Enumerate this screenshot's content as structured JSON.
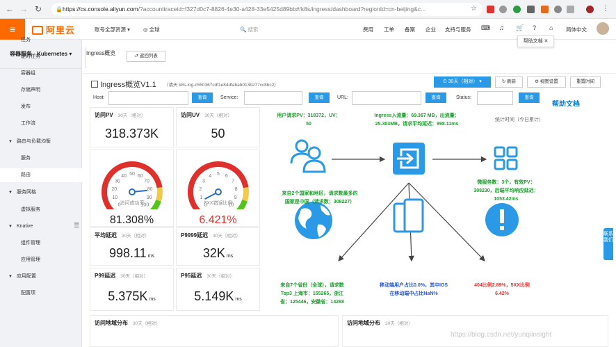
{
  "browser": {
    "url_host": "https://cs.console.aliyun.com",
    "url_rest": "/?accounttraceid=f327d0c7-8826-4e30-a428-33e5425d89bb#/k8s/ingress/dashboard?regionId=cn-beijing&c..."
  },
  "topbar": {
    "logo": "阿里云",
    "account_menu": "账号全部资源 ▾",
    "region": "全球",
    "search_placeholder": "搜索",
    "links": [
      "费用",
      "工单",
      "备案",
      "企业",
      "支持与服务"
    ],
    "lang": "简体中文",
    "help_tip": "帮助文档 ✕"
  },
  "sidebar": {
    "title": "容器服务 - Kubernetes ▾",
    "items": [
      {
        "label": "任务",
        "group": false
      },
      {
        "label": "定时任务",
        "group": false
      },
      {
        "label": "容器组",
        "group": false
      },
      {
        "label": "存储声明",
        "group": false
      },
      {
        "label": "发布",
        "group": false
      },
      {
        "label": "工作流",
        "group": false
      },
      {
        "label": "路由与负载均衡",
        "group": true
      },
      {
        "label": "服务",
        "group": false
      },
      {
        "label": "路由",
        "group": false,
        "active": true
      },
      {
        "label": "服务网格",
        "group": true
      },
      {
        "label": "虚拟服务",
        "group": false
      },
      {
        "label": "Knative",
        "group": true
      },
      {
        "label": "组件管理",
        "group": false
      },
      {
        "label": "应用管理",
        "group": false
      },
      {
        "label": "应用配置",
        "group": true
      },
      {
        "label": "配置项",
        "group": false
      }
    ]
  },
  "header": {
    "crumb": "Ingress概览",
    "back_label": "⮐ 返回列表",
    "dashboard_title": "Ingress概览V1.1",
    "dashboard_id": "（请天 k8s-log-c550367cdf1e84dfabab013b277cc8bc2）",
    "time_range": "⏱ 30天（相对） ▾",
    "refresh": "↻ 刷新",
    "settings": "⚙ 视图设置",
    "reset_time": "重置时间"
  },
  "filters": {
    "host_label": "Host:",
    "service_label": "Service:",
    "url_label": "URL:",
    "status_label": "Status:",
    "query_label": "查询",
    "help_link": "帮助文档"
  },
  "cards": {
    "pv": {
      "title": "访问PV",
      "sub": "30天（相对）",
      "value": "318.373K"
    },
    "uv": {
      "title": "访问UV",
      "sub": "30天（相对）",
      "value": "50"
    },
    "success": {
      "caption": "访问成功率",
      "value": "81.308%",
      "fraction": 0.81308,
      "ticks": [
        "0",
        "10",
        "20",
        "30",
        "40",
        "50",
        "60",
        "70",
        "80",
        "90",
        "100"
      ]
    },
    "err5xx": {
      "caption": "5XX错误比例",
      "value": "6.421%",
      "fraction": 0.06421,
      "ticks": [
        "0",
        "1",
        "2",
        "3",
        "4",
        "5",
        "6",
        "7",
        "8",
        "9",
        "10"
      ]
    },
    "avg": {
      "title": "平均延迟",
      "sub": "30天（相对）",
      "value": "998.11",
      "unit": "ms"
    },
    "p9999": {
      "title": "P9999延迟",
      "sub": "30天（相对）",
      "value": "32K",
      "unit": "ms"
    },
    "p99": {
      "title": "P99延迟",
      "sub": "30天（相对）",
      "value": "5.375K",
      "unit": "ms"
    },
    "p95": {
      "title": "P95延迟",
      "sub": "30天（相对）",
      "value": "5.149K",
      "unit": "ms"
    },
    "geo1": {
      "title": "访问地域分布",
      "sub": "30天（相对）"
    },
    "geo2": {
      "title": "访问地域分布",
      "sub": "30天（相对）"
    }
  },
  "overview": {
    "user_line1": "用户请求PV：318372，UV：",
    "user_line2": "50",
    "ingress_line1": "Ingress入流量：69.367 MB，出流量：",
    "ingress_line2": "25.303MB，请求平均延迟：998.11ms",
    "stat_time": "统计时间（今日累计）",
    "region_line1": "来自2个国家和地区，请求数最多的",
    "region_line2": "国家是中国（请求数：308227）",
    "svc_line1": "微服务数：3个，有效PV：",
    "svc_line2": "308230，后端平均响应延迟：",
    "svc_line3": "1053.42ms",
    "province_line1": "来自7个省份（全球），请求数",
    "province_line2": "Top3 上海市：155265，浙江",
    "province_line3": "省：125446，安徽省：14268",
    "mobile_line1": "移动端用户占比0.0%，其中IOS",
    "mobile_line2": "在移动端中占比NaN%",
    "err_line1": "404比例2.89%，5XX比例",
    "err_line2": "6.42%"
  },
  "misc": {
    "contact": "联系我们",
    "watermark": "https://blog.csdn.net/yunqiinsight"
  },
  "colors": {
    "brand": "#ff6a00",
    "primary": "#2a9ae6",
    "green": "#1a9c2a",
    "red": "#e0302c"
  }
}
